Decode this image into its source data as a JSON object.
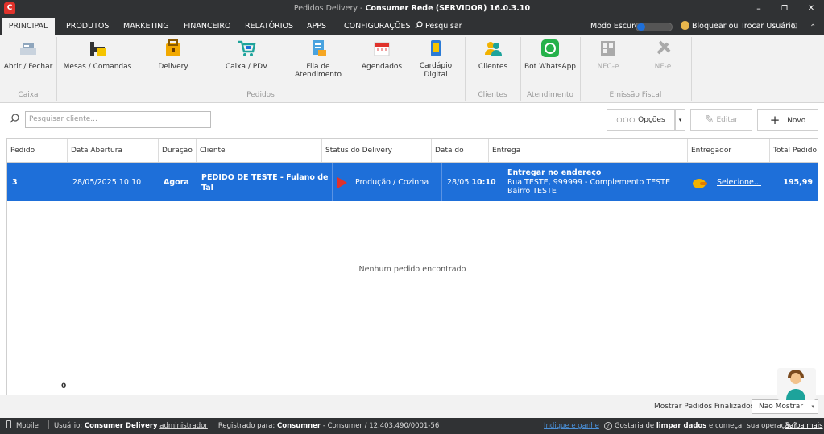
{
  "window": {
    "logo": "C",
    "title_prefix": "Pedidos Delivery - ",
    "title_main": "Consumer Rede (SERVIDOR) 16.0.3.10",
    "minimize": "–",
    "maximize": "❐",
    "close": "✕"
  },
  "menu": {
    "tabs": [
      "PRINCIPAL",
      "PRODUTOS",
      "MARKETING",
      "FINANCEIRO",
      "RELATÓRIOS",
      "APPS",
      "CONFIGURAÇÕES",
      "Pesquisar"
    ],
    "dark_mode_label": "Modo Escuro",
    "lock_label": "Bloquear ou Trocar Usuário",
    "pin_icon": "⊡",
    "collapse_icon": "⌃"
  },
  "ribbon": {
    "buttons": [
      {
        "label": "Abrir / Fechar",
        "icon": "cash-register-icon"
      },
      {
        "label": "Mesas / Comandas",
        "icon": "table-icon"
      },
      {
        "label": "Delivery",
        "icon": "delivery-bag-icon"
      },
      {
        "label": "Caixa / PDV",
        "icon": "cart-icon"
      },
      {
        "label": "Fila de Atendimento",
        "icon": "queue-icon"
      },
      {
        "label": "Agendados",
        "icon": "calendar-icon"
      },
      {
        "label": "Cardápio Digital",
        "icon": "digital-menu-icon"
      },
      {
        "label": "Clientes",
        "icon": "customers-icon"
      },
      {
        "label": "Bot WhatsApp",
        "icon": "whatsapp-icon"
      },
      {
        "label": "NFC-e",
        "icon": "qr-code-icon"
      },
      {
        "label": "NF-e",
        "icon": "nfe-icon"
      }
    ],
    "groups": [
      "Caixa",
      "Pedidos",
      "Clientes",
      "Atendimento",
      "Emissão Fiscal"
    ]
  },
  "toolbar": {
    "search_placeholder": "Pesquisar cliente...",
    "options_label": "Opções",
    "edit_label": "Editar",
    "new_label": "Novo"
  },
  "grid": {
    "columns": [
      "Pedido",
      "Data Abertura",
      "Duração",
      "Cliente",
      "Status do Delivery",
      "Data do Status",
      "Entrega",
      "Entregador",
      "Total Pedido"
    ],
    "row": {
      "pedido": "3",
      "data_abertura": "28/05/2025 10:10",
      "duracao": "Agora",
      "cliente": "PEDIDO DE TESTE - Fulano de Tal",
      "status": "Produção / Cozinha",
      "data_status_day": "28/05",
      "data_status_time": "10:10",
      "entrega_title": "Entregar no endereço",
      "entrega_line1": "Rua TESTE, 999999 - Complemento TESTE",
      "entrega_line2": "Bairro TESTE",
      "entregador": "Selecione...",
      "total": "195,99"
    },
    "empty_text": "Nenhum pedido encontrado",
    "footer_count": "0"
  },
  "bottom": {
    "show_finished_label": "Mostrar Pedidos Finalizados:",
    "show_finished_value": "Não Mostrar"
  },
  "status": {
    "mobile": "Mobile",
    "user_label": "Usuário:",
    "user_name": "Consumer Delivery",
    "user_role": "administrador",
    "registered_label": "Registrado para:",
    "registered_name": "Consumner",
    "registered_rest": "- Consumer / 12.403.490/0001-56",
    "indique": "Indique e ganhe",
    "question_pre": "Gostaria de",
    "question_bold": "limpar dados",
    "question_post": "e começar sua operação?",
    "more": "Saiba mais"
  },
  "colors": {
    "selection": "#1e6fd9",
    "titlebar": "#303234",
    "ribbon": "#f2f2f2",
    "status_red": "#e0322b"
  }
}
